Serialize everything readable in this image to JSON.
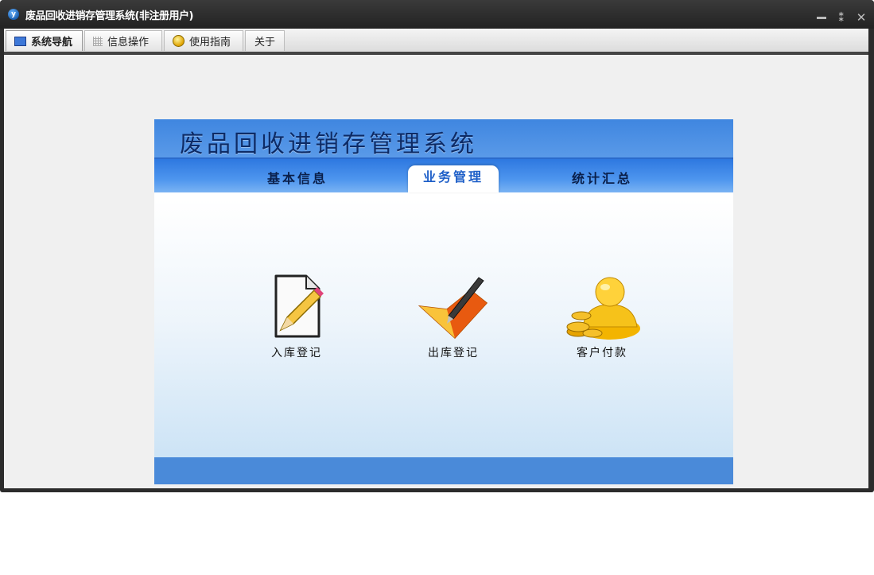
{
  "window": {
    "title": "废品回收进销存管理系统(非注册用户)",
    "app_icon": "y"
  },
  "menu": {
    "tabs": [
      {
        "label": "系统导航",
        "icon": "monitor-icon"
      },
      {
        "label": "信息操作",
        "icon": "grid-icon"
      },
      {
        "label": "使用指南",
        "icon": "help-icon"
      },
      {
        "label": "关于",
        "icon": ""
      }
    ]
  },
  "panel": {
    "title": "废品回收进销存管理系统",
    "tabs": [
      "基本信息",
      "业务管理",
      "统计汇总"
    ],
    "tiles": [
      {
        "label": "入库登记",
        "icon": "pencil-document-icon"
      },
      {
        "label": "出库登记",
        "icon": "folder-pen-icon"
      },
      {
        "label": "客户付款",
        "icon": "user-coins-icon"
      }
    ]
  },
  "colors": {
    "header_blue": "#3f86e0",
    "title_dark_blue": "#0d2b66",
    "active_tab_text": "#1e5fc8"
  }
}
